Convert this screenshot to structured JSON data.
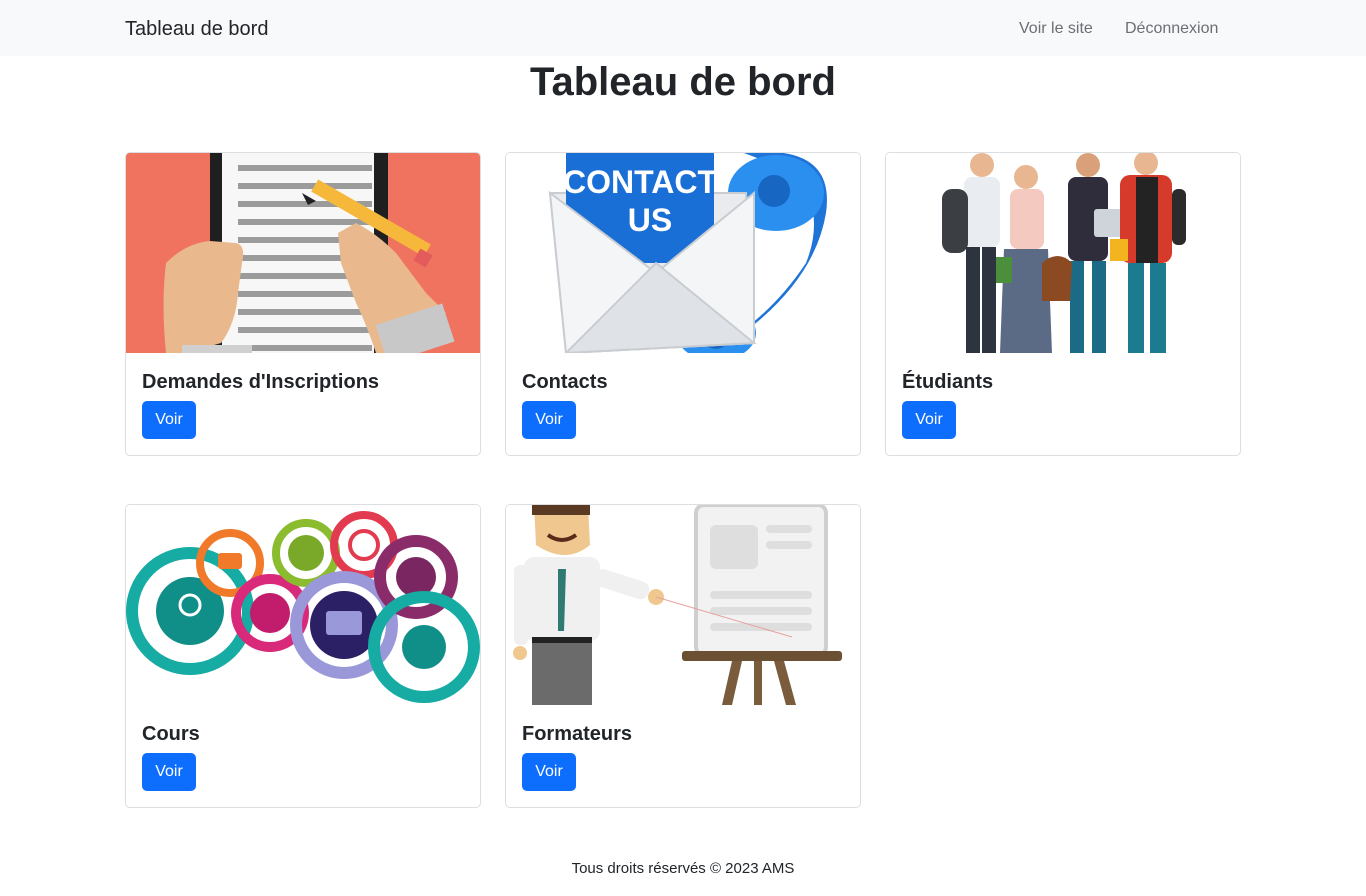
{
  "navbar": {
    "brand": "Tableau de bord",
    "links": [
      {
        "label": "Voir le site"
      },
      {
        "label": "Déconnexion"
      }
    ]
  },
  "page": {
    "title": "Tableau de bord"
  },
  "cards": [
    {
      "title": "Demandes d'Inscriptions",
      "button": "Voir",
      "image": "registration-form-illustration"
    },
    {
      "title": "Contacts",
      "button": "Voir",
      "image": "contact-us-envelope-phone-illustration"
    },
    {
      "title": "Étudiants",
      "button": "Voir",
      "image": "students-group-illustration"
    },
    {
      "title": "Cours",
      "button": "Voir",
      "image": "courses-icons-circles-illustration"
    },
    {
      "title": "Formateurs",
      "button": "Voir",
      "image": "trainer-presentation-illustration"
    }
  ],
  "images": {
    "contact_text_line1": "CONTACT",
    "contact_text_line2": "US"
  },
  "footer": {
    "text": "Tous droits réservés © 2023 AMS"
  }
}
